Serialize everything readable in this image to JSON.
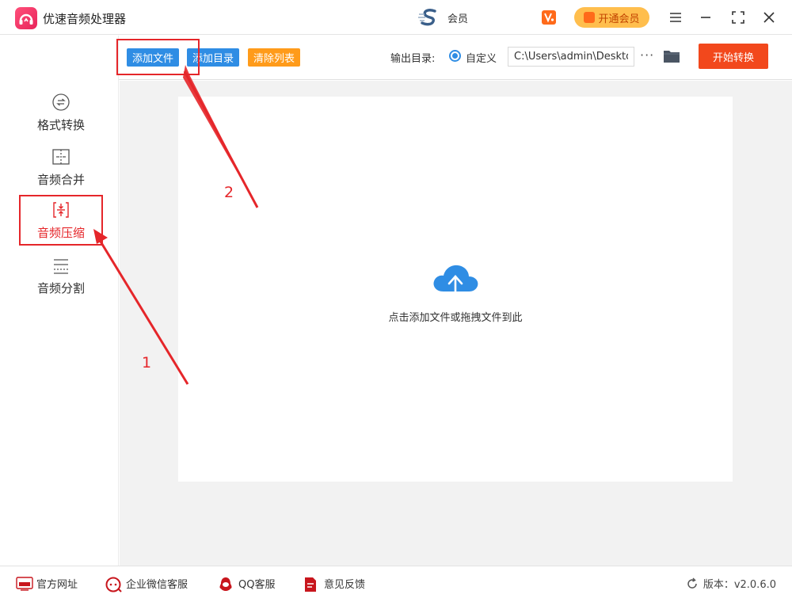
{
  "app": {
    "title": "优速音频处理器"
  },
  "header": {
    "member_label": "会员",
    "open_vip_label": "开通会员"
  },
  "sidebar": {
    "items": [
      {
        "label": "格式转换",
        "icon": "format-convert-icon"
      },
      {
        "label": "音频合并",
        "icon": "merge-icon"
      },
      {
        "label": "音频压缩",
        "icon": "compress-icon",
        "active": true
      },
      {
        "label": "音频分割",
        "icon": "split-icon"
      }
    ]
  },
  "toolbar": {
    "add_file_label": "添加文件",
    "add_dir_label": "添加目录",
    "clear_list_label": "清除列表",
    "output_dir_label": "输出目录:",
    "custom_label": "自定义",
    "output_path": "C:\\Users\\admin\\Deskto",
    "more_label": "···",
    "start_label": "开始转换"
  },
  "main": {
    "drop_hint": "点击添加文件或拖拽文件到此"
  },
  "annotations": {
    "step1": "1",
    "step2": "2"
  },
  "footer": {
    "website": "官方网址",
    "wechat": "企业微信客服",
    "qq": "QQ客服",
    "feedback": "意见反馈",
    "version": "版本：v2.0.6.0"
  },
  "colors": {
    "accent_blue": "#2f8de4",
    "accent_orange": "#ff9b1a",
    "start_red": "#f2481c",
    "annotation_red": "#e5262a"
  }
}
